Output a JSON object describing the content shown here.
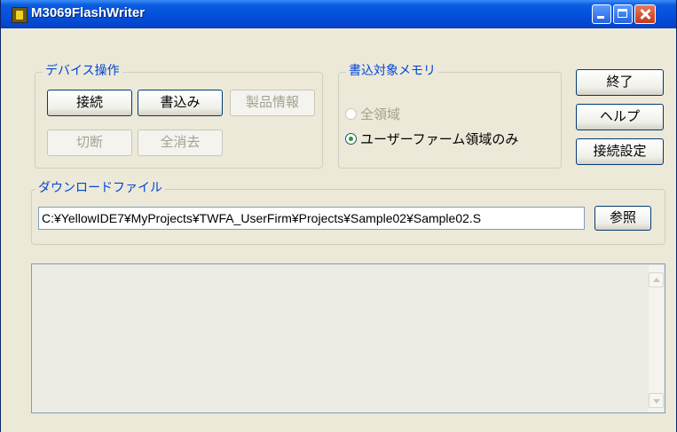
{
  "window": {
    "title": "M3069FlashWriter"
  },
  "device_ops": {
    "label": "デバイス操作",
    "connect": "接続",
    "write": "書込み",
    "product_info": "製品情報",
    "disconnect": "切断",
    "erase_all": "全消去"
  },
  "target_memory": {
    "label": "書込対象メモリ",
    "option_all": "全領域",
    "option_userfirm": "ユーザーファーム領域のみ",
    "selected": "ユーザーファーム領域のみ"
  },
  "side_buttons": {
    "exit": "終了",
    "help": "ヘルプ",
    "connection_settings": "接続設定"
  },
  "download": {
    "label": "ダウンロードファイル",
    "path": "C:¥YellowIDE7¥MyProjects¥TWFA_UserFirm¥Projects¥Sample02¥Sample02.S",
    "browse": "参照"
  }
}
